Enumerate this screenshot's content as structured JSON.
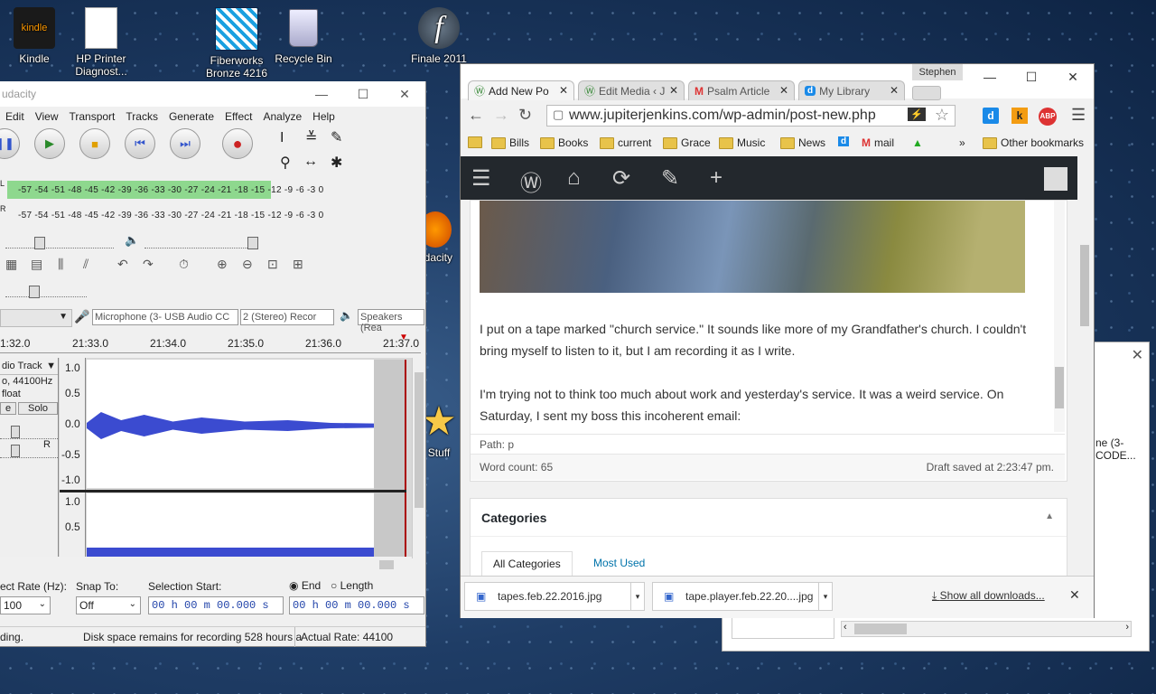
{
  "desktop": {
    "icons": [
      {
        "label": "Kindle",
        "icon": "kindle-icon"
      },
      {
        "label": "HP Printer Diagnost...",
        "icon": "document-icon"
      },
      {
        "label": "Fiberworks Bronze 4216",
        "icon": "fiberworks-icon"
      },
      {
        "label": "Recycle Bin",
        "icon": "recycle-bin-icon"
      },
      {
        "label": "Finale 2011",
        "icon": "finale-icon"
      },
      {
        "label": "udacity",
        "icon": "audacity-icon"
      },
      {
        "label": "Stuff",
        "icon": "star-icon"
      }
    ]
  },
  "audacity": {
    "title": "udacity",
    "menu": [
      "Edit",
      "View",
      "Transport",
      "Tracks",
      "Generate",
      "Effect",
      "Analyze",
      "Help"
    ],
    "meter_ticks": "-57 -54 -51 -48 -45 -42 -39 -36 -33 -30 -27 -24 -21 -18 -15 -12  -9  -6  -3  0",
    "meter_channels": [
      "L",
      "R"
    ],
    "recording_device": "Microphone (3- USB Audio CC",
    "recording_channels": "2 (Stereo) Recor",
    "playback_device": "Speakers (Rea",
    "timeline": [
      "1:32.0",
      "21:33.0",
      "21:34.0",
      "21:35.0",
      "21:36.0",
      "21:37.0"
    ],
    "track": {
      "name": "dio Track",
      "format": "o, 44100Hz",
      "bit": "float",
      "mute": "e",
      "solo": "Solo",
      "scale": [
        "1.0",
        "0.5",
        "0.0",
        "-0.5",
        "-1.0"
      ],
      "scale2": [
        "1.0",
        "0.5"
      ],
      "gain_label": "R"
    },
    "bottom": {
      "rate_label": "ect Rate (Hz):",
      "rate_value": "100",
      "snap_label": "Snap To:",
      "snap_value": "Off",
      "selection_label": "Selection Start:",
      "end_label": "End",
      "length_label": "Length",
      "time1": "00 h 00 m 00.000 s",
      "time2": "00 h 00 m 00.000 s"
    },
    "status": {
      "left": "ding.",
      "disk": "Disk space remains for recording 528 hours a",
      "rate": "Actual Rate: 44100"
    }
  },
  "chrome": {
    "user": "Stephen",
    "tabs": [
      {
        "label": "Add New Po",
        "icon": "wordpress-icon"
      },
      {
        "label": "Edit Media ‹ J",
        "icon": "wordpress-icon"
      },
      {
        "label": "Psalm Article",
        "icon": "gmail-icon"
      },
      {
        "label": "My Library",
        "icon": "dashlane-icon"
      }
    ],
    "url": "www.jupiterjenkins.com/wp-admin/post-new.php",
    "bookmarks": [
      "Bills",
      "Books",
      "current",
      "Grace",
      "Music",
      "News",
      "mail",
      "Other bookmarks"
    ],
    "more": "»",
    "editor_text": [
      "I put on a tape marked \"church service.\" It sounds like more of my Grandfather's church. I couldn't bring myself to listen to it, but I am recording it as I write.",
      "I'm trying not to think too much about work and yesterday's service. It was a weird service. On Saturday, I sent my boss this incoherent email:"
    ],
    "path": "Path: p",
    "word_count": "Word count: 65",
    "draft": "Draft saved at 2:23:47 pm.",
    "categories_title": "Categories",
    "cat_tabs": [
      "All Categories",
      "Most Used"
    ],
    "downloads": [
      "tapes.feb.22.2016.jpg",
      "tape.player.feb.22.20....jpg"
    ],
    "show_all": "Show all downloads..."
  },
  "dialog": {
    "text1": "ne (3-",
    "text2": "CODE..."
  }
}
